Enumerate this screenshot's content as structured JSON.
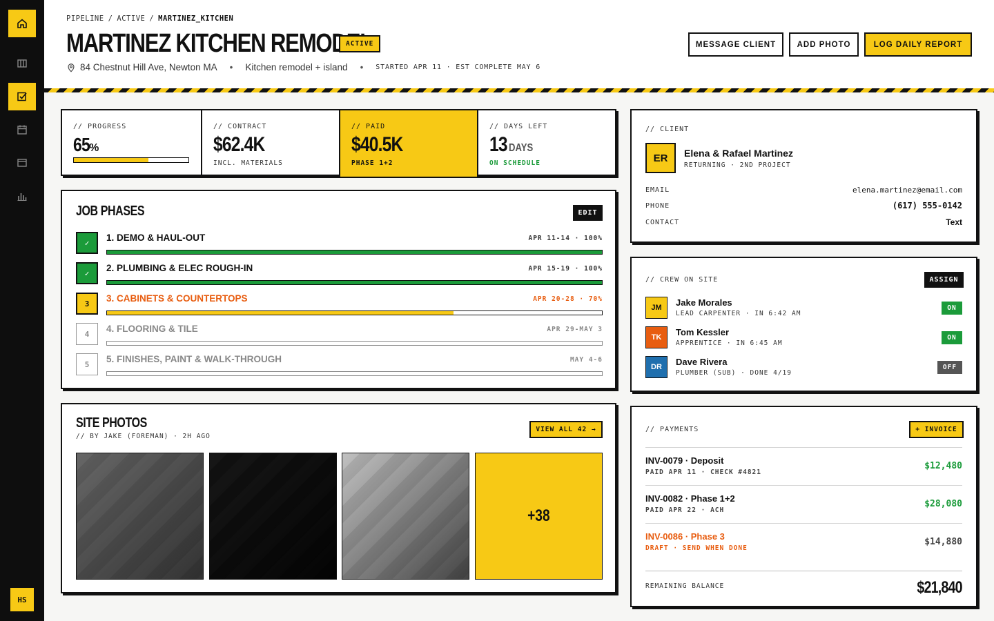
{
  "sidebar": {
    "items": [
      {
        "icon": "home-icon",
        "active": true
      },
      {
        "icon": "columns-icon",
        "active": false
      },
      {
        "icon": "checklist-icon",
        "active": true
      },
      {
        "icon": "calendar-icon",
        "active": false
      },
      {
        "icon": "card-icon",
        "active": false
      },
      {
        "icon": "bar-chart-icon",
        "active": false
      }
    ],
    "user_initials": "HS"
  },
  "header": {
    "breadcrumb": [
      "PIPELINE",
      "ACTIVE",
      "MARTINEZ_KITCHEN"
    ],
    "breadcrumb_sep": "/",
    "title": "MARTINEZ KITCHEN REMODEL",
    "status": "ACTIVE",
    "address": "84 Chestnut Hill Ave, Newton MA",
    "job_type": "Kitchen remodel + island",
    "dates": "STARTED APR 11 · EST COMPLETE MAY 6",
    "buttons": {
      "message": "MESSAGE CLIENT",
      "photo": "ADD PHOTO",
      "report": "LOG DAILY REPORT"
    }
  },
  "stats": {
    "progress": {
      "label": "// PROGRESS",
      "value": "65",
      "unit": "%",
      "fraction": 0.65
    },
    "contract": {
      "label": "// CONTRACT",
      "value": "$62.4K",
      "sub": "INCL. MATERIALS"
    },
    "paid": {
      "label": "// PAID",
      "value": "$40.5K",
      "sub": "PHASE 1+2"
    },
    "days": {
      "label": "// DAYS LEFT",
      "value": "13",
      "unit": "DAYS",
      "sub": "ON SCHEDULE"
    }
  },
  "phases": {
    "title": "JOB PHASES",
    "edit": "EDIT",
    "items": [
      {
        "num": "✓",
        "name": "1. DEMO & HAUL-OUT",
        "dates": "APR 11-14 · 100%",
        "progress": 1.0,
        "state": "done"
      },
      {
        "num": "✓",
        "name": "2. PLUMBING & ELEC ROUGH-IN",
        "dates": "APR 15-19 · 100%",
        "progress": 1.0,
        "state": "done"
      },
      {
        "num": "3",
        "name": "3. CABINETS & COUNTERTOPS",
        "dates": "APR 20-28 · 70%",
        "progress": 0.7,
        "state": "current"
      },
      {
        "num": "4",
        "name": "4. FLOORING & TILE",
        "dates": "APR 29-MAY 3",
        "progress": 0,
        "state": "pending"
      },
      {
        "num": "5",
        "name": "5. FINISHES, PAINT & WALK-THROUGH",
        "dates": "MAY 4-6",
        "progress": 0,
        "state": "pending"
      }
    ]
  },
  "photos": {
    "title": "SITE PHOTOS",
    "subtitle": "// BY JAKE (FOREMAN) · 2H AGO",
    "view_all": "VIEW ALL 42 →",
    "more": "+38"
  },
  "client": {
    "label": "// CLIENT",
    "initials": "ER",
    "name": "Elena & Rafael Martinez",
    "tag": "RETURNING · 2ND PROJECT",
    "rows": [
      {
        "label": "EMAIL",
        "value": "elena.martinez@email.com"
      },
      {
        "label": "PHONE",
        "value": "(617) 555-0142"
      },
      {
        "label": "CONTACT",
        "value": "Text"
      }
    ]
  },
  "crew": {
    "label": "// CREW ON SITE",
    "assign": "ASSIGN",
    "members": [
      {
        "initials": "JM",
        "name": "Jake Morales",
        "detail": "LEAD CARPENTER · IN 6:42 AM",
        "status": "ON",
        "color": "#f7c915"
      },
      {
        "initials": "TK",
        "name": "Tom Kessler",
        "detail": "APPRENTICE · IN 6:45 AM",
        "status": "ON",
        "color": "#e85d10"
      },
      {
        "initials": "DR",
        "name": "Dave Rivera",
        "detail": "PLUMBER (SUB) · DONE 4/19",
        "status": "OFF",
        "color": "#1f6fae"
      }
    ]
  },
  "payments": {
    "label": "// PAYMENTS",
    "invoice_button": "+ INVOICE",
    "items": [
      {
        "title": "INV-0079 · Deposit",
        "detail": "PAID APR 11 · CHECK #4821",
        "amount": "$12,480",
        "state": "paid"
      },
      {
        "title": "INV-0082 · Phase 1+2",
        "detail": "PAID APR 22 · ACH",
        "amount": "$28,080",
        "state": "paid"
      },
      {
        "title": "INV-0086 · Phase 3",
        "detail": "DRAFT · SEND WHEN DONE",
        "amount": "$14,880",
        "state": "draft"
      }
    ],
    "balance_label": "REMAINING BALANCE",
    "balance": "$21,840"
  },
  "colors": {
    "accent": "#f7c915",
    "ink": "#111111",
    "success": "#1b9b3a",
    "warning": "#e85d10",
    "muted": "#555555"
  }
}
